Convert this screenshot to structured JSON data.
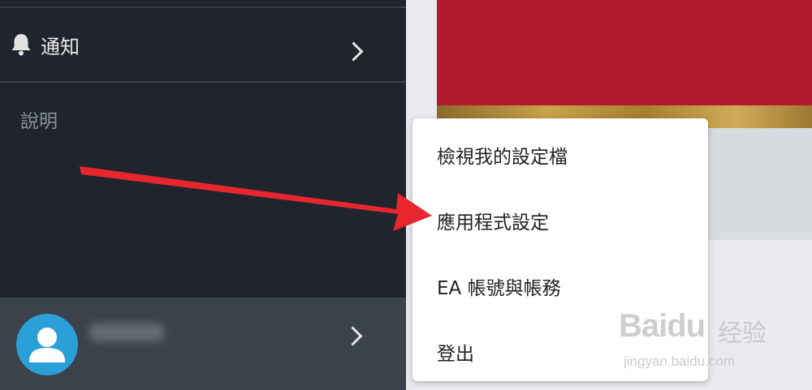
{
  "sidebar": {
    "notifications_label": "通知",
    "help_label": "說明"
  },
  "menu": {
    "items": [
      {
        "label": "檢視我的設定檔"
      },
      {
        "label": "應用程式設定"
      },
      {
        "label": "EA 帳號與帳務"
      },
      {
        "label": "登出"
      }
    ]
  },
  "watermark": {
    "logo": "Baidu",
    "text": "经验",
    "url": "jingyan.baidu.com"
  },
  "colors": {
    "sidebar_bg": "#20252d",
    "account_bar_bg": "#3b424b",
    "avatar_bg": "#2a9fd8",
    "hero_red": "#b01b2d",
    "arrow_red": "#e8262e"
  },
  "icons": [
    "bell-icon",
    "chevron-right-icon",
    "user-icon",
    "arrow-pointer"
  ]
}
